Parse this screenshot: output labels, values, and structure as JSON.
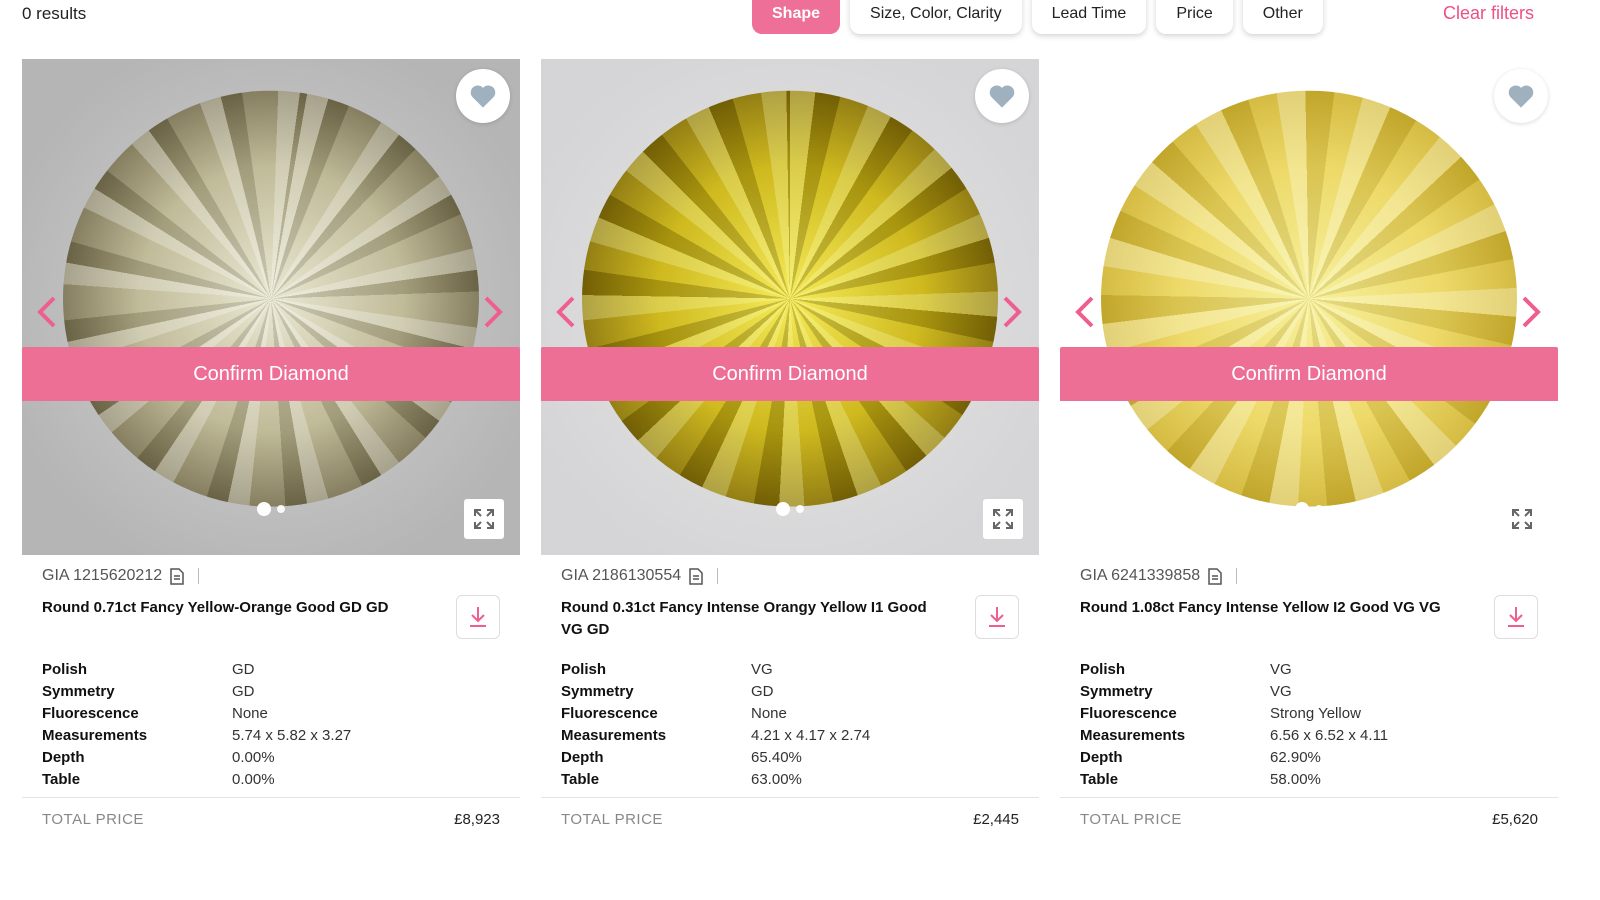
{
  "header": {
    "results": "0 results",
    "filters": [
      "Shape",
      "Size, Color, Clarity",
      "Lead Time",
      "Price",
      "Other"
    ],
    "clear_filters": "Clear filters"
  },
  "colors": {
    "accent": "#ee6f97",
    "clear_link": "#ee4f86"
  },
  "icons": [
    "heart-icon",
    "chevron-left-icon",
    "chevron-right-icon",
    "expand-icon",
    "certificate-icon",
    "download-icon"
  ],
  "cards": [
    {
      "gia": "GIA 1215620212",
      "title": "Round 0.71ct Fancy Yellow-Orange  Good GD GD",
      "specs": [
        {
          "label": "Polish",
          "value": "GD"
        },
        {
          "label": "Symmetry",
          "value": "GD"
        },
        {
          "label": "Fluorescence",
          "value": "None"
        },
        {
          "label": "Measurements",
          "value": "5.74 x 5.82 x 3.27"
        },
        {
          "label": "Depth",
          "value": "0.00%"
        },
        {
          "label": "Table",
          "value": "0.00%"
        }
      ],
      "total_price_label": "TOTAL PRICE",
      "total_price": "£8,923",
      "confirm_label": "Confirm Diamond"
    },
    {
      "gia": "GIA 2186130554",
      "title": "Round 0.31ct Fancy Intense Orangy Yellow I1 Good VG GD",
      "specs": [
        {
          "label": "Polish",
          "value": "VG"
        },
        {
          "label": "Symmetry",
          "value": "GD"
        },
        {
          "label": "Fluorescence",
          "value": "None"
        },
        {
          "label": "Measurements",
          "value": "4.21 x 4.17 x 2.74"
        },
        {
          "label": "Depth",
          "value": "65.40%"
        },
        {
          "label": "Table",
          "value": "63.00%"
        }
      ],
      "total_price_label": "TOTAL PRICE",
      "total_price": "£2,445",
      "confirm_label": "Confirm Diamond"
    },
    {
      "gia": "GIA 6241339858",
      "title": "Round 1.08ct Fancy Intense Yellow I2 Good VG VG",
      "specs": [
        {
          "label": "Polish",
          "value": "VG"
        },
        {
          "label": "Symmetry",
          "value": "VG"
        },
        {
          "label": "Fluorescence",
          "value": "Strong Yellow"
        },
        {
          "label": "Measurements",
          "value": "6.56 x 6.52 x 4.11"
        },
        {
          "label": "Depth",
          "value": "62.90%"
        },
        {
          "label": "Table",
          "value": "58.00%"
        }
      ],
      "total_price_label": "TOTAL PRICE",
      "total_price": "£5,620",
      "confirm_label": "Confirm Diamond"
    }
  ]
}
